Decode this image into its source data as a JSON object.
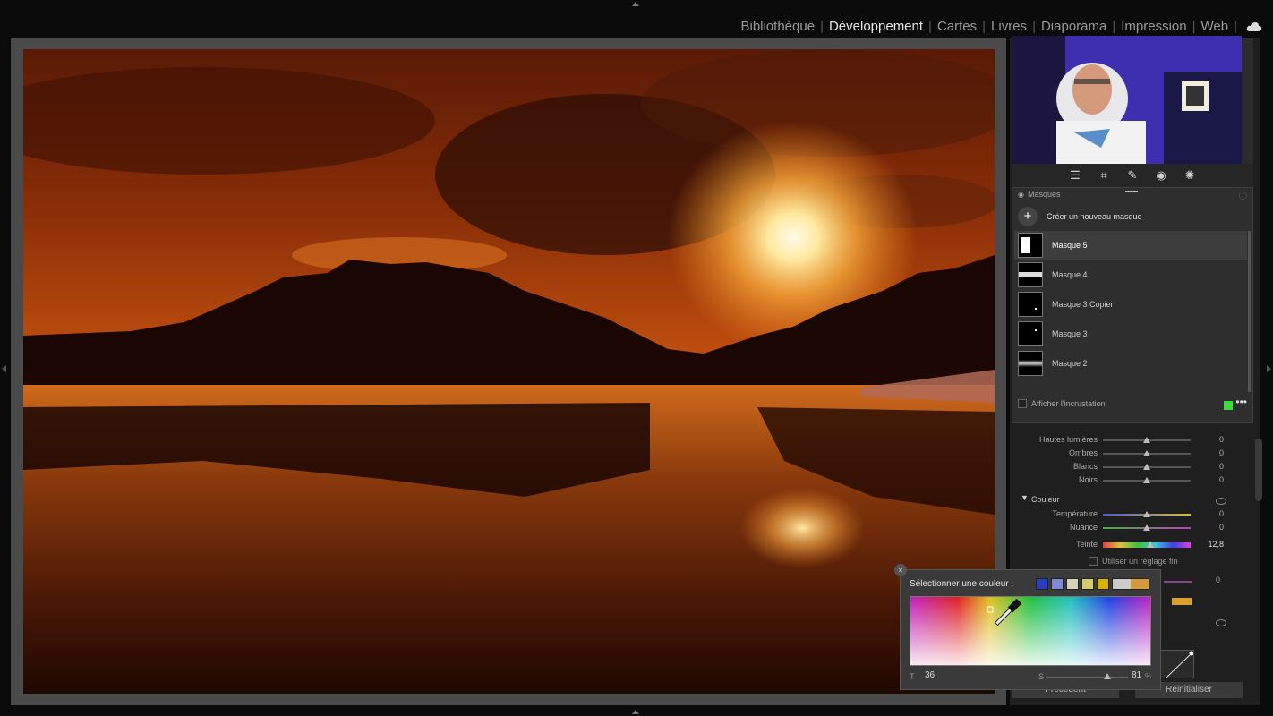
{
  "modules": {
    "items": [
      "Bibliothèque",
      "Développement",
      "Cartes",
      "Livres",
      "Diaporama",
      "Impression",
      "Web"
    ],
    "active": "Développement",
    "separator": "|"
  },
  "masks_panel": {
    "title": "Masques",
    "create_label": "Créer un nouveau masque",
    "items": [
      {
        "label": "Masque 5",
        "selected": true
      },
      {
        "label": "Masque 4",
        "selected": false
      },
      {
        "label": "Masque 3 Copier",
        "selected": false
      },
      {
        "label": "Masque 3",
        "selected": false
      },
      {
        "label": "Masque 2",
        "selected": false
      }
    ],
    "overlay_label": "Afficher l'incrustation",
    "overlay_color": "#3ddc3d"
  },
  "tone": {
    "rows": [
      {
        "label": "Hautes lumières",
        "value": "0"
      },
      {
        "label": "Ombres",
        "value": "0"
      },
      {
        "label": "Blancs",
        "value": "0"
      },
      {
        "label": "Noirs",
        "value": "0"
      }
    ]
  },
  "color": {
    "section_title": "Couleur",
    "rows": [
      {
        "label": "Température",
        "value": "0"
      },
      {
        "label": "Nuance",
        "value": "0"
      },
      {
        "label": "Teinte",
        "value": "12,8"
      }
    ],
    "fine_label": "Utiliser un réglage fin",
    "extra_value": "0"
  },
  "picker": {
    "title": "Sélectionner une couleur :",
    "swatches": [
      "#2a3fbf",
      "#7d8ad6",
      "#d8d2b4",
      "#d8cc6a",
      "#d8b000"
    ],
    "current": [
      "#cccccc",
      "#d49a3a"
    ],
    "hue_label": "T",
    "hue_value": "36",
    "sat_label": "S",
    "sat_value": "81",
    "sat_unit": "%"
  },
  "buttons": {
    "previous": "Précédent",
    "reset": "Réinitialiser"
  }
}
